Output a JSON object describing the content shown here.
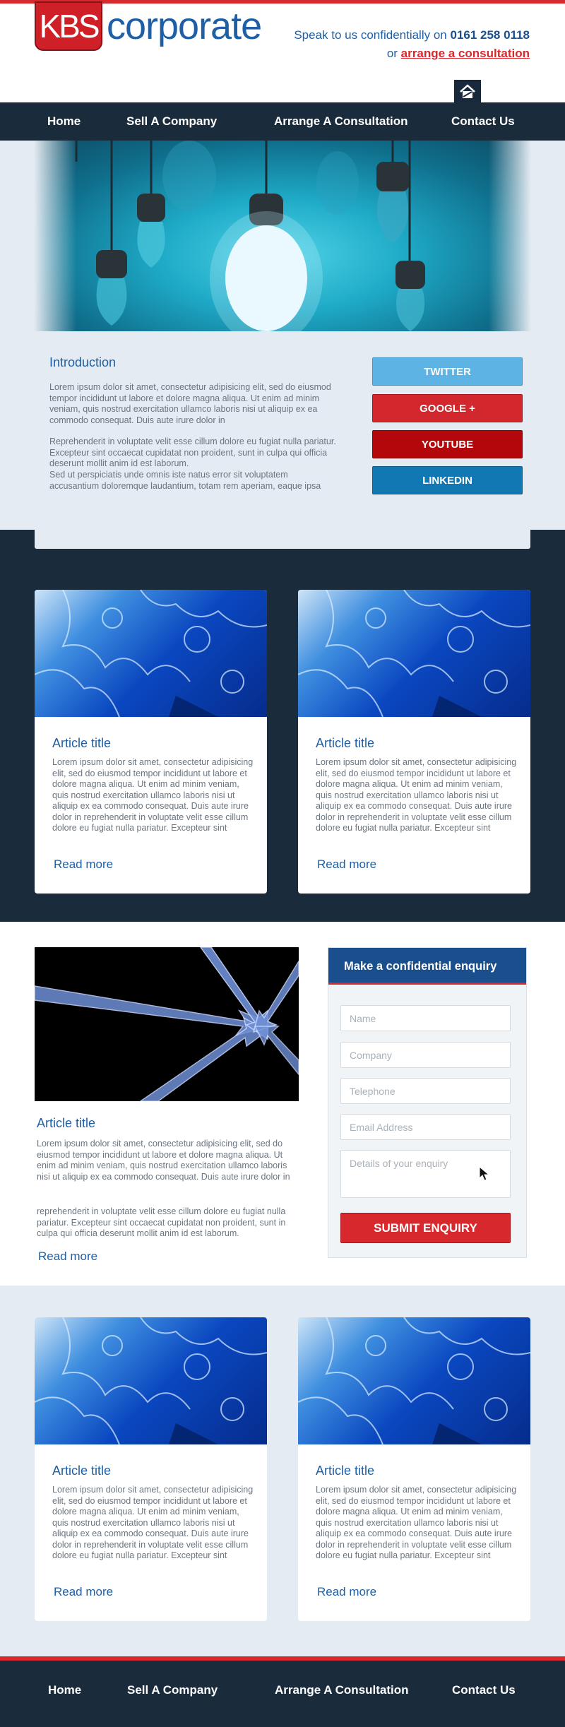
{
  "brand": {
    "logo_box": "KBS",
    "logo_text": "corporate"
  },
  "header": {
    "contact_prefix": "Speak to us confidentially on",
    "phone": "0161 258 0118",
    "or_text": "or",
    "consult_link": "arrange a consultation"
  },
  "nav": {
    "items": [
      "Home",
      "Sell A Company",
      "Arrange A Consultation",
      "Contact Us"
    ]
  },
  "intro": {
    "title": "Introduction",
    "p1": "Lorem ipsum dolor sit amet, consectetur adipisicing elit, sed do eiusmod tempor incididunt ut labore et dolore magna aliqua. Ut enim ad minim veniam, quis nostrud exercitation ullamco laboris nisi ut aliquip ex ea commodo consequat. Duis aute irure dolor in",
    "p2": "Reprehenderit in voluptate velit esse cillum dolore eu fugiat nulla pariatur. Excepteur sint occaecat cupidatat non proident, sunt in culpa qui officia deserunt mollit anim id est laborum.",
    "p3": "Sed ut perspiciatis unde omnis iste natus error sit voluptatem accusantium doloremque laudantium, totam rem aperiam, eaque ipsa"
  },
  "social": {
    "twitter": {
      "label": "TWITTER",
      "color": "#5db3e3"
    },
    "google": {
      "label": "GOOGLE +",
      "color": "#d1272d"
    },
    "youtube": {
      "label": "YOUTUBE",
      "color": "#b3070c"
    },
    "linkedin": {
      "label": "LINKEDIN",
      "color": "#1278b3"
    }
  },
  "articles_dark": [
    {
      "title": "Article title",
      "body": "Lorem ipsum dolor sit amet, consectetur adipisicing elit, sed do eiusmod tempor incididunt ut labore et dolore magna aliqua. Ut enim ad minim veniam, quis nostrud exercitation ullamco laboris nisi ut aliquip ex ea commodo consequat. Duis aute irure dolor in reprehenderit in voluptate velit esse cillum dolore eu fugiat nulla pariatur. Excepteur sint",
      "more": "Read more"
    },
    {
      "title": "Article title",
      "body": "Lorem ipsum dolor sit amet, consectetur adipisicing elit, sed do eiusmod tempor incididunt ut labore et dolore magna aliqua. Ut enim ad minim veniam, quis nostrud exercitation ullamco laboris nisi ut aliquip ex ea commodo consequat. Duis aute irure dolor in reprehenderit in voluptate velit esse cillum dolore eu fugiat nulla pariatur. Excepteur sint",
      "more": "Read more"
    }
  ],
  "feature": {
    "title": "Article title",
    "p1": "Lorem ipsum dolor sit amet, consectetur adipisicing elit, sed do eiusmod tempor incididunt ut labore et dolore magna aliqua. Ut enim ad minim veniam, quis nostrud exercitation ullamco laboris nisi ut aliquip ex ea commodo consequat. Duis aute irure dolor in",
    "p2": "reprehenderit in voluptate velit esse cillum dolore eu fugiat nulla pariatur. Excepteur sint occaecat cupidatat non proident, sunt in culpa qui officia deserunt mollit anim id est laborum.",
    "more": "Read more"
  },
  "enquiry": {
    "title": "Make a confidential enquiry",
    "name_placeholder": "Name",
    "company_placeholder": "Company",
    "telephone_placeholder": "Telephone",
    "email_placeholder": "Email Address",
    "details_placeholder": "Details of your enquiry",
    "submit": "SUBMIT ENQUIRY"
  },
  "articles_light": [
    {
      "title": "Article title",
      "body": "Lorem ipsum dolor sit amet, consectetur adipisicing elit, sed do eiusmod tempor incididunt ut labore et dolore magna aliqua. Ut enim ad minim veniam, quis nostrud exercitation ullamco laboris nisi ut aliquip ex ea commodo consequat. Duis aute irure dolor in reprehenderit in voluptate velit esse cillum dolore eu fugiat nulla pariatur. Excepteur sint",
      "more": "Read more"
    },
    {
      "title": "Article title",
      "body": "Lorem ipsum dolor sit amet, consectetur adipisicing elit, sed do eiusmod tempor incididunt ut labore et dolore magna aliqua. Ut enim ad minim veniam, quis nostrud exercitation ullamco laboris nisi ut aliquip ex ea commodo consequat. Duis aute irure dolor in reprehenderit in voluptate velit esse cillum dolore eu fugiat nulla pariatur. Excepteur sint",
      "more": "Read more"
    }
  ],
  "footer": {
    "items": [
      "Home",
      "Sell A Company",
      "Arrange A Consultation",
      "Contact Us"
    ]
  },
  "colors": {
    "brand_red": "#d7282d",
    "brand_blue": "#1e5fa5",
    "navy": "#1a2b3c",
    "light_band": "#e4ebf2"
  },
  "icons": {
    "home": "home-icon"
  }
}
